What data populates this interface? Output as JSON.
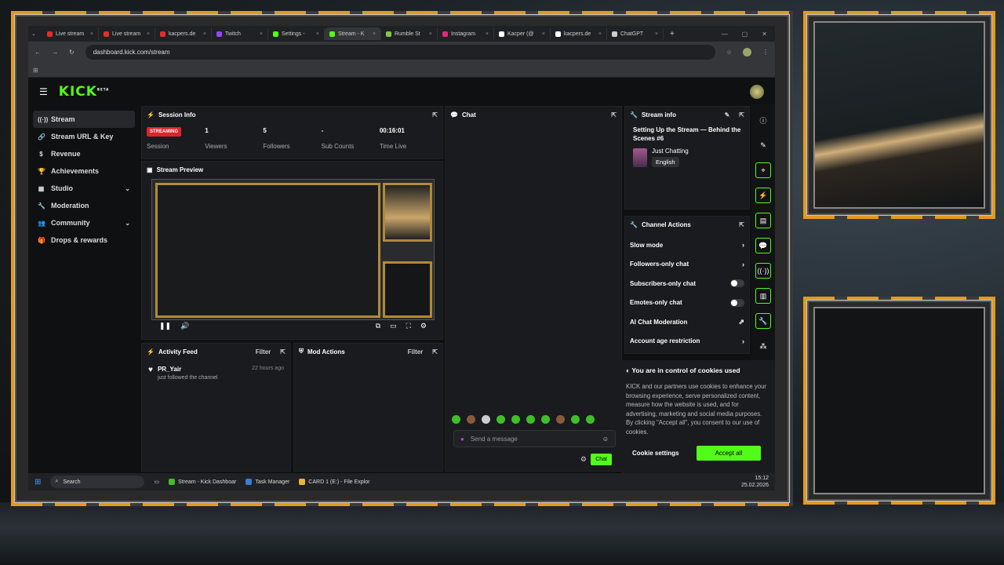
{
  "browser": {
    "tabs": [
      {
        "label": "Live stream",
        "color": "#e52d27"
      },
      {
        "label": "Live stream",
        "color": "#e52d27"
      },
      {
        "label": "kacpers.de",
        "color": "#e52d27"
      },
      {
        "label": "Twitch",
        "color": "#9146ff"
      },
      {
        "label": "Settings - ",
        "color": "#53fc18"
      },
      {
        "label": "Stream - K",
        "color": "#53fc18",
        "active": true
      },
      {
        "label": "Rumble St",
        "color": "#85c742"
      },
      {
        "label": "Instagram",
        "color": "#dd2a7b"
      },
      {
        "label": "Kacper (@",
        "color": "#ffffff"
      },
      {
        "label": "kacpers.de",
        "color": "#ffffff"
      },
      {
        "label": "ChatGPT",
        "color": "#cccccc"
      }
    ],
    "url": "dashboard.kick.com/stream"
  },
  "header": {
    "logo": "KICK",
    "logo_sup": "BETA"
  },
  "sidebar": {
    "items": [
      {
        "label": "Stream",
        "icon": "((·))"
      },
      {
        "label": "Stream URL & Key",
        "icon": "🔗"
      },
      {
        "label": "Revenue",
        "icon": "$"
      },
      {
        "label": "Achievements",
        "icon": "🏆"
      },
      {
        "label": "Studio",
        "icon": "▦"
      },
      {
        "label": "Moderation",
        "icon": "🔧"
      },
      {
        "label": "Community",
        "icon": "👥"
      },
      {
        "label": "Drops & rewards",
        "icon": "🎁"
      }
    ]
  },
  "session": {
    "title": "Session Info",
    "badge": "STREAMING",
    "stats": [
      {
        "label": "Session"
      },
      {
        "value": "1",
        "label": "Viewers"
      },
      {
        "value": "5",
        "label": "Followers"
      },
      {
        "value": "-",
        "label": "Sub Counts"
      },
      {
        "value": "00:16:01",
        "label": "Time Live"
      }
    ]
  },
  "preview": {
    "title": "Stream Preview"
  },
  "activity": {
    "title": "Activity Feed",
    "filter": "Filter",
    "items": [
      {
        "name": "PR_Yair",
        "text": "just followed the channel",
        "time": "22 hours ago"
      }
    ]
  },
  "mod": {
    "title": "Mod Actions",
    "filter": "Filter"
  },
  "chat": {
    "title": "Chat",
    "placeholder": "Send a message",
    "send": "Chat"
  },
  "stream_info": {
    "title": "Stream info",
    "stream_title": "Setting Up the Stream — Behind the Scenes #6",
    "category": "Just Chatting",
    "language": "English"
  },
  "channel_actions": {
    "title": "Channel Actions",
    "rows": [
      {
        "label": "Slow mode",
        "kind": "arrow"
      },
      {
        "label": "Followers-only chat",
        "kind": "arrow"
      },
      {
        "label": "Subscribers-only chat",
        "kind": "toggle"
      },
      {
        "label": "Emotes-only chat",
        "kind": "toggle"
      },
      {
        "label": "AI Chat Moderation",
        "kind": "external"
      },
      {
        "label": "Account age restriction",
        "kind": "arrow"
      }
    ]
  },
  "cookies": {
    "title": "You are in control of cookies used",
    "body": "KICK and our partners use cookies to enhance your browsing experience, serve personalized content, measure how the website is used, and for advertising, marketing and social media purposes. By clicking \"Accept all\", you consent to our use of cookies.",
    "settings": "Cookie settings",
    "accept": "Accept all"
  },
  "taskbar": {
    "search": "Search",
    "apps": [
      {
        "label": "Stream - Kick Dashboar",
        "color": "#3fbf2a"
      },
      {
        "label": "Task Manager",
        "color": "#3a7bd5"
      },
      {
        "label": "CARD 1 (E:) - File Explor",
        "color": "#e8b43a"
      }
    ],
    "time": "15:12",
    "date": "25.02.2026"
  },
  "colors": {
    "accent": "#53fc18",
    "live": "#e0242b",
    "frame_orange": "#e39a1b"
  }
}
